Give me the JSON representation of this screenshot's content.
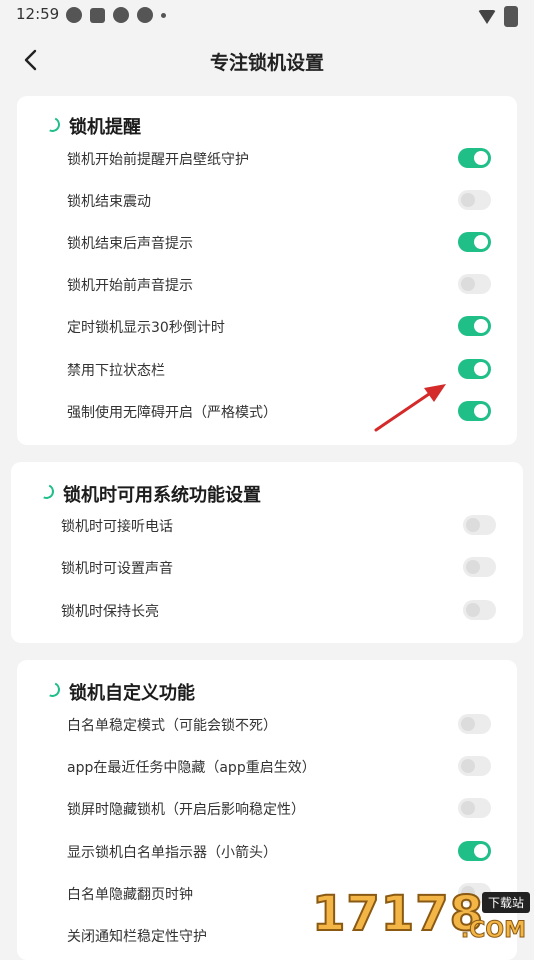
{
  "status_bar": {
    "time": "12:59"
  },
  "header": {
    "title": "专注锁机设置"
  },
  "sections": [
    {
      "title": "锁机提醒",
      "items": [
        {
          "label": "锁机开始前提醒开启壁纸守护",
          "on": true
        },
        {
          "label": "锁机结束震动",
          "on": false
        },
        {
          "label": "锁机结束后声音提示",
          "on": true
        },
        {
          "label": "锁机开始前声音提示",
          "on": false
        },
        {
          "label": "定时锁机显示30秒倒计时",
          "on": true
        },
        {
          "label": "禁用下拉状态栏",
          "on": true
        },
        {
          "label": "强制使用无障碍开启（严格模式）",
          "on": true
        }
      ]
    },
    {
      "title": "锁机时可用系统功能设置",
      "items": [
        {
          "label": "锁机时可接听电话",
          "on": false
        },
        {
          "label": "锁机时可设置声音",
          "on": false
        },
        {
          "label": "锁机时保持长亮",
          "on": false
        }
      ]
    },
    {
      "title": "锁机自定义功能",
      "items": [
        {
          "label": "白名单稳定模式（可能会锁不死）",
          "on": false
        },
        {
          "label": "app在最近任务中隐藏（app重启生效）",
          "on": false
        },
        {
          "label": "锁屏时隐藏锁机（开启后影响稳定性）",
          "on": false
        },
        {
          "label": "显示锁机白名单指示器（小箭头）",
          "on": true
        },
        {
          "label": "白名单隐藏翻页时钟",
          "on": false
        },
        {
          "label": "关闭通知栏稳定性守护",
          "on": false
        }
      ]
    }
  ],
  "watermark": {
    "digits": "17178",
    "badge": "下载站",
    "domain": ".COM"
  },
  "colors": {
    "accent": "#1fbf87",
    "background": "#f3f3f3",
    "card": "#ffffff",
    "annotation": "#d42a2a"
  }
}
